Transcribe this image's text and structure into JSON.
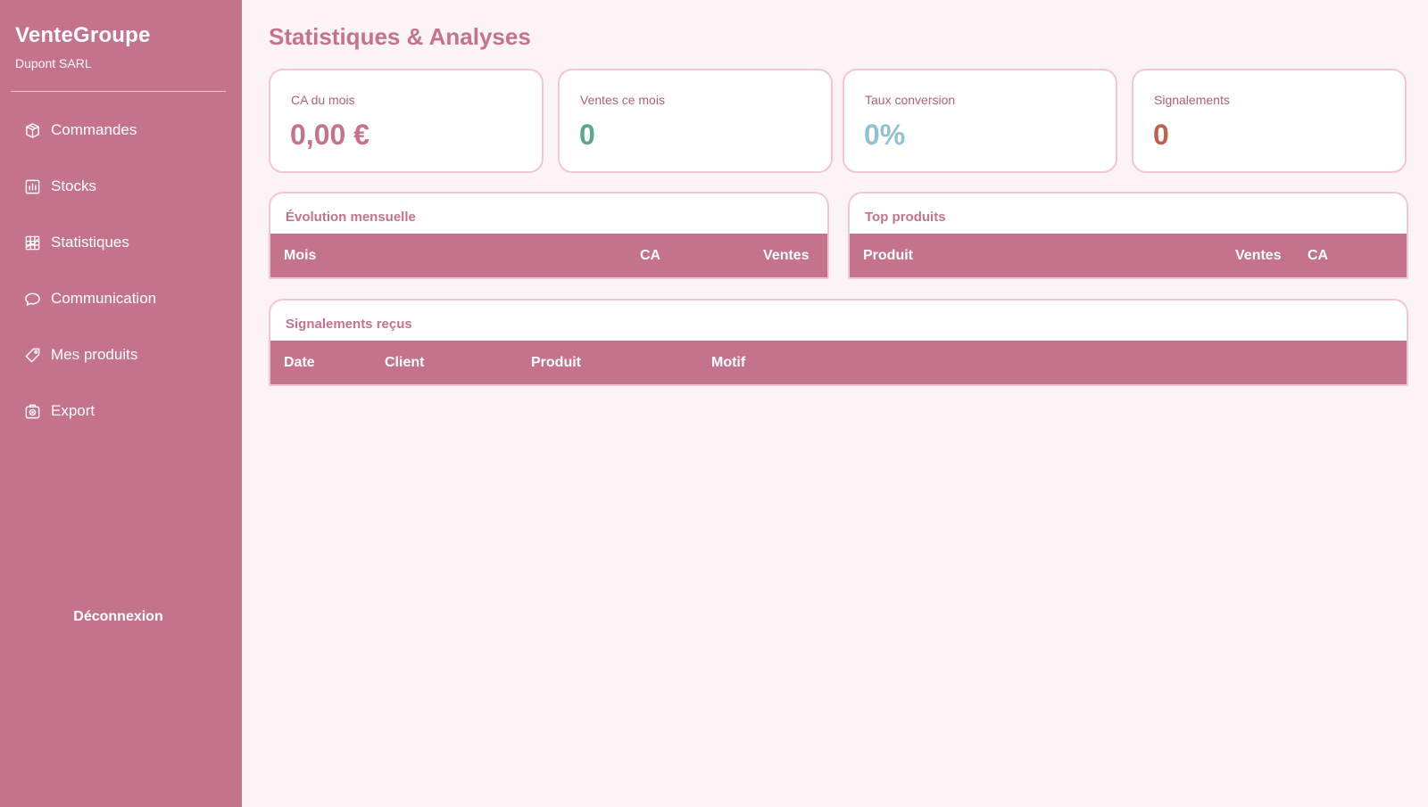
{
  "sidebar": {
    "brand": "VenteGroupe",
    "company": "Dupont SARL",
    "items": [
      {
        "label": "Commandes",
        "icon": "box-icon"
      },
      {
        "label": "Stocks",
        "icon": "bar-chart-icon"
      },
      {
        "label": "Statistiques",
        "icon": "chart-grid-icon"
      },
      {
        "label": "Communication",
        "icon": "speech-bubble-icon"
      },
      {
        "label": "Mes produits",
        "icon": "tag-icon"
      },
      {
        "label": "Export",
        "icon": "export-icon"
      }
    ],
    "logout": "Déconnexion"
  },
  "page": {
    "title": "Statistiques & Analyses"
  },
  "stats": [
    {
      "label": "CA du mois",
      "value": "0,00 €",
      "color": "#c5738c"
    },
    {
      "label": "Ventes ce mois",
      "value": "0",
      "color": "#5ea68a"
    },
    {
      "label": "Taux conversion",
      "value": "0%",
      "color": "#92c0d3"
    },
    {
      "label": "Signalements",
      "value": "0",
      "color": "#c0614f"
    }
  ],
  "panels": {
    "monthly": {
      "title": "Évolution mensuelle",
      "columns": [
        "Mois",
        "CA",
        "Ventes"
      ],
      "rows": []
    },
    "top_products": {
      "title": "Top produits",
      "columns": [
        "Produit",
        "Ventes",
        "CA"
      ],
      "rows": []
    },
    "reports": {
      "title": "Signalements reçus",
      "columns": [
        "Date",
        "Client",
        "Produit",
        "Motif"
      ],
      "rows": []
    }
  },
  "colors": {
    "accent": "#c5738c",
    "background": "#fcf3f6",
    "card_border": "#f2c7d4"
  }
}
